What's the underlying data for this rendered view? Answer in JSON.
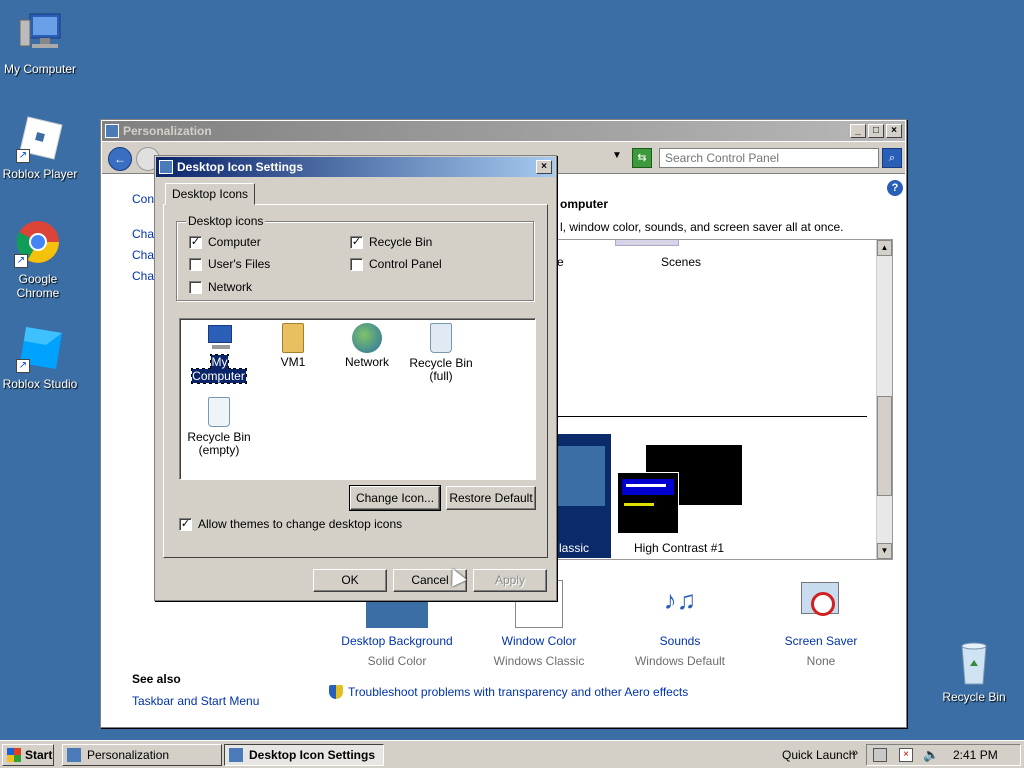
{
  "desktop": {
    "icons": [
      {
        "label": "My Computer"
      },
      {
        "label": "Roblox Player"
      },
      {
        "label": "Google Chrome"
      },
      {
        "label": "Roblox Studio"
      },
      {
        "label": "Recycle Bin"
      }
    ]
  },
  "personalization": {
    "title": "Personalization",
    "search_placeholder": "Search Control Panel",
    "sidebar_links": [
      "Cont",
      "Char",
      "Char",
      "Char"
    ],
    "heading_partial": "omputer",
    "description_partial": "l, window color, sounds, and screen saver all at once.",
    "theme_labels": [
      "e",
      "Scenes",
      "lassic",
      "High Contrast #1"
    ],
    "items": [
      {
        "label": "Desktop Background",
        "sub": "Solid Color"
      },
      {
        "label": "Window Color",
        "sub": "Windows Classic"
      },
      {
        "label": "Sounds",
        "sub": "Windows Default"
      },
      {
        "label": "Screen Saver",
        "sub": "None"
      }
    ],
    "see_also": "See also",
    "taskbar_link": "Taskbar and Start Menu",
    "troubleshoot_link": "Troubleshoot problems with transparency and other Aero effects"
  },
  "dialog": {
    "title": "Desktop Icon Settings",
    "tab": "Desktop Icons",
    "group_label": "Desktop icons",
    "checkboxes": [
      {
        "label": "Computer",
        "checked": true
      },
      {
        "label": "Recycle Bin",
        "checked": true
      },
      {
        "label": "User's Files",
        "checked": false
      },
      {
        "label": "Control Panel",
        "checked": false
      },
      {
        "label": "Network",
        "checked": false
      }
    ],
    "icon_list": [
      {
        "label": "My Computer"
      },
      {
        "label": "VM1"
      },
      {
        "label": "Network"
      },
      {
        "label": "Recycle Bin",
        "label2": "(full)"
      },
      {
        "label": "Recycle Bin",
        "label2": "(empty)"
      }
    ],
    "change_icon": "Change Icon...",
    "restore_default": "Restore Default",
    "allow_themes": "Allow themes to change desktop icons",
    "ok": "OK",
    "cancel": "Cancel",
    "apply": "Apply"
  },
  "taskbar": {
    "start": "Start",
    "tasks": [
      "Personalization",
      "Desktop Icon Settings"
    ],
    "quick_launch": "Quick Launch",
    "clock": "2:41 PM"
  }
}
